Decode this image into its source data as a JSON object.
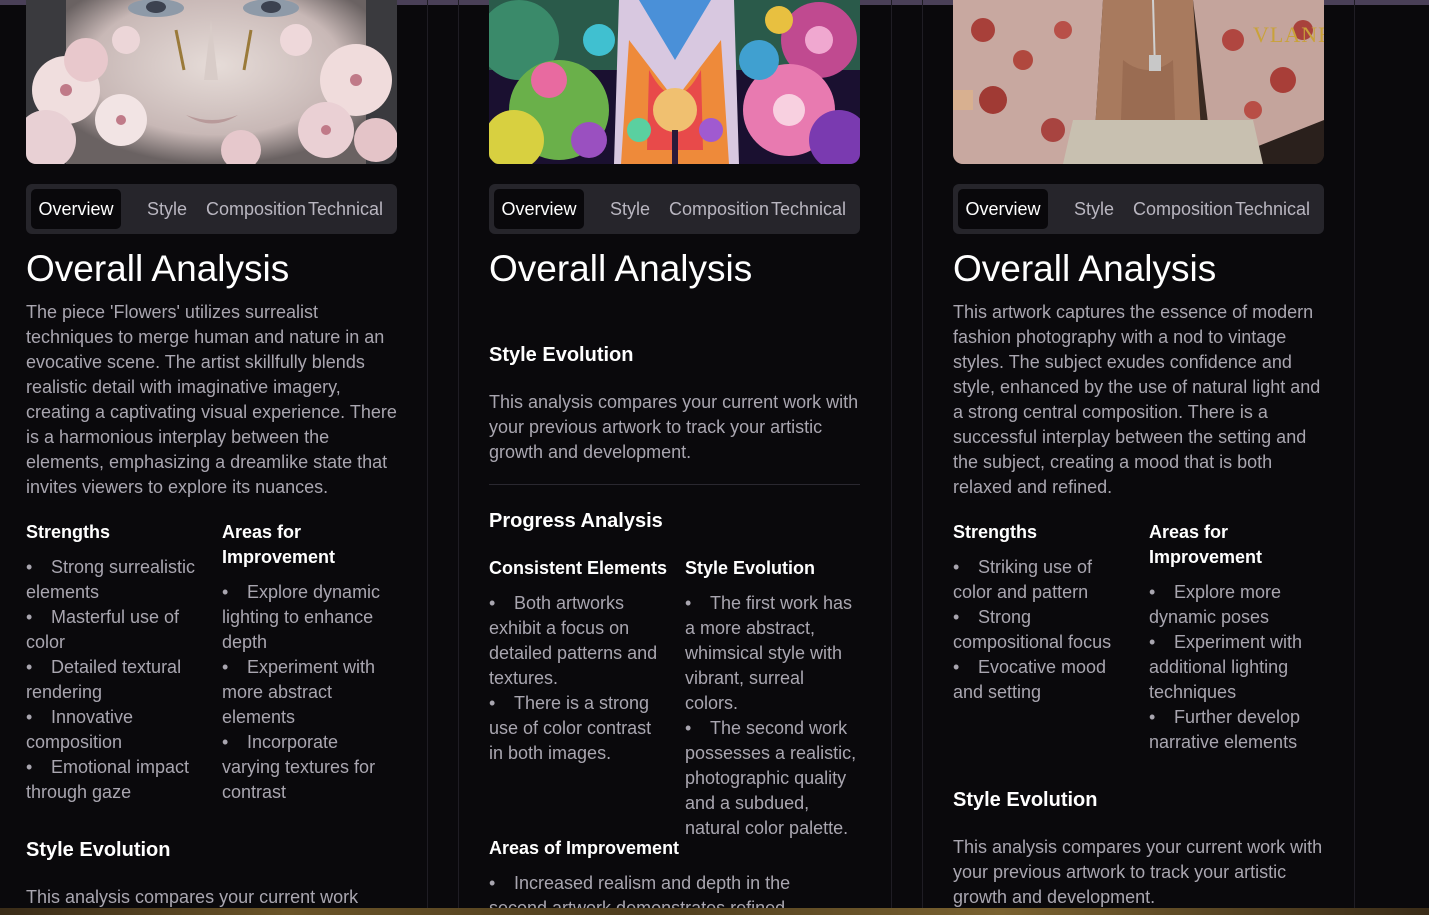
{
  "tabs": [
    "Overview",
    "Style",
    "Composition",
    "Technical"
  ],
  "cards": [
    {
      "watermark": "",
      "overview_title": "Overall Analysis",
      "overview_text": "The piece 'Flowers' utilizes surrealist techniques to merge human and nature in an evocative scene. The artist skillfully blends realistic detail with imaginative imagery, creating a captivating visual experience. There is a harmonious interplay between the elements, emphasizing a dreamlike state that invites viewers to explore its nuances.",
      "strengths_heading": "Strengths",
      "strengths": [
        "Strong surrealistic elements",
        "Masterful use of color",
        "Detailed textural rendering",
        "Innovative composition",
        "Emotional impact through gaze"
      ],
      "improve_heading": "Areas for Improvement",
      "improvements": [
        "Explore dynamic lighting to enhance depth",
        "Experiment with more abstract elements",
        "Incorporate varying textures for contrast"
      ],
      "style_evolution_heading": "Style Evolution",
      "style_evolution_text": "This analysis compares your current work"
    },
    {
      "overview_title": "Overall Analysis",
      "style_evolution_heading": "Style Evolution",
      "style_evolution_text": "This analysis compares your current work with your previous artwork to track your artistic growth and development.",
      "progress_heading": "Progress Analysis",
      "consistent_heading": "Consistent Elements",
      "consistent": [
        "Both artworks exhibit a focus on detailed patterns and textures.",
        "There is a strong use of color contrast in both images."
      ],
      "evolution_heading": "Style Evolution",
      "evolution": [
        "The first work has a more abstract, whimsical style with vibrant, surreal colors.",
        "The second work possesses a realistic, photographic quality and a subdued, natural color palette."
      ],
      "areas_heading": "Areas of Improvement",
      "areas": [
        "Increased realism and depth in the second artwork demonstrates refined technical skill"
      ]
    },
    {
      "watermark": "VLANE",
      "overview_title": "Overall Analysis",
      "overview_text": "This artwork captures the essence of modern fashion photography with a nod to vintage styles. The subject exudes confidence and style, enhanced by the use of natural light and a strong central composition. There is a successful interplay between the setting and the subject, creating a mood that is both relaxed and refined.",
      "strengths_heading": "Strengths",
      "strengths": [
        "Striking use of color and pattern",
        "Strong compositional focus",
        "Evocative mood and setting"
      ],
      "improve_heading": "Areas for Improvement",
      "improvements": [
        "Explore more dynamic poses",
        "Experiment with additional lighting techniques",
        "Further develop narrative elements"
      ],
      "style_evolution_heading": "Style Evolution",
      "style_evolution_text": "This analysis compares your current work with your previous artwork to track your artistic growth and development."
    }
  ]
}
